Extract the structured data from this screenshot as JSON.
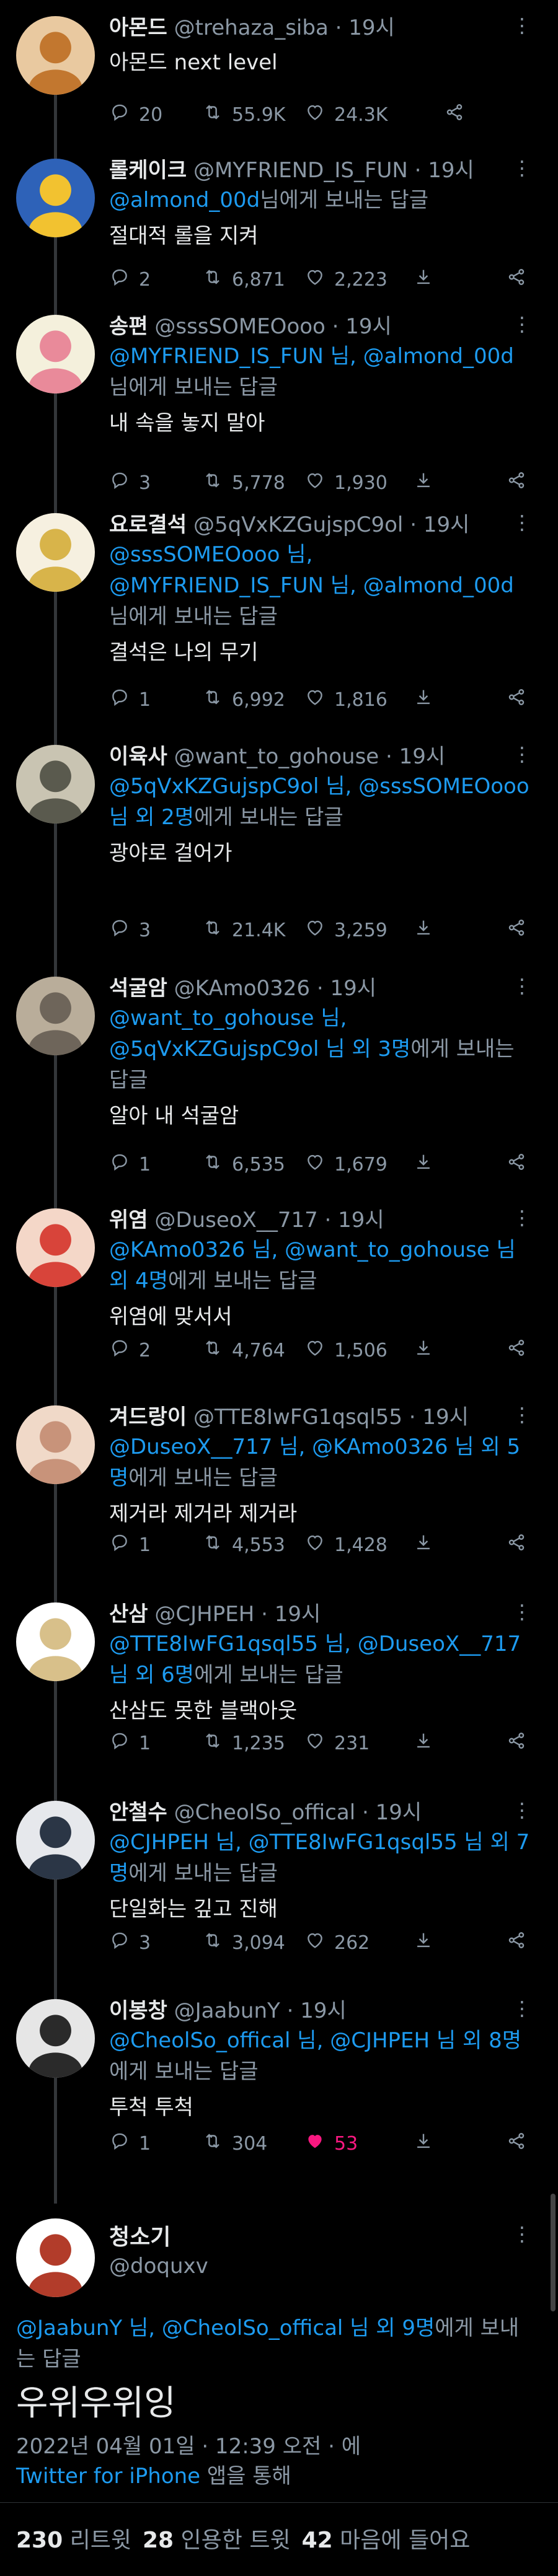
{
  "tweets": [
    {
      "name": "아몬드",
      "handle": "@trehaza_siba",
      "time": "19시",
      "replying_to": [],
      "reply_suffix": "",
      "text": "아몬드 next level",
      "replies": "20",
      "retweets": "55.9K",
      "likes": "24.3K",
      "avatar_colors": [
        "#c2772f",
        "#e9c9a0"
      ]
    },
    {
      "name": "롤케이크",
      "handle": "@MYFRIEND_IS_FUN",
      "time": "19시",
      "replying_to": [
        "@almond_00d"
      ],
      "reply_suffix": "님에게 보내는 답글",
      "text": "절대적 롤을 지켜",
      "replies": "2",
      "retweets": "6,871",
      "likes": "2,223",
      "avatar_colors": [
        "#f2c230",
        "#2e62b8"
      ]
    },
    {
      "name": "송편",
      "handle": "@sssSOMEOooo",
      "time": "19시",
      "replying_to": [
        "@MYFRIEND_IS_FUN 님",
        "@almond_00d"
      ],
      "reply_suffix": "님에게 보내는 답글",
      "text": "내 속을 놓지 말아",
      "replies": "3",
      "retweets": "5,778",
      "likes": "1,930",
      "avatar_colors": [
        "#e98a9a",
        "#f4f0dc"
      ]
    },
    {
      "name": "요로결석",
      "handle": "@5qVxKZGujspC9ol",
      "time": "19시",
      "replying_to": [
        "@sssSOMEOooo 님",
        "@MYFRIEND_IS_FUN 님",
        "@almond_00d"
      ],
      "reply_suffix": "님에게 보내는 답글",
      "text": "결석은 나의 무기",
      "replies": "1",
      "retweets": "6,992",
      "likes": "1,816",
      "avatar_colors": [
        "#d8b44a",
        "#f6f0e0"
      ]
    },
    {
      "name": "이육사",
      "handle": "@want_to_gohouse",
      "time": "19시",
      "replying_to": [
        "@5qVxKZGujspC9ol 님",
        "@sssSOMEOooo 님 외 2명"
      ],
      "reply_suffix": "에게 보내는 답글",
      "text": "광야로 걸어가",
      "replies": "3",
      "retweets": "21.4K",
      "likes": "3,259",
      "avatar_colors": [
        "#5a5a4e",
        "#c9c4b2"
      ]
    },
    {
      "name": "석굴암",
      "handle": "@KAmo0326",
      "time": "19시",
      "replying_to": [
        "@want_to_gohouse 님",
        "@5qVxKZGujspC9ol 님 외 3명"
      ],
      "reply_suffix": "에게 보내는 답글",
      "text": "알아 내 석굴암",
      "replies": "1",
      "retweets": "6,535",
      "likes": "1,679",
      "avatar_colors": [
        "#6e655a",
        "#b9ad9a"
      ]
    },
    {
      "name": "위염",
      "handle": "@DuseoX__717",
      "time": "19시",
      "replying_to": [
        "@KAmo0326 님",
        "@want_to_gohouse 님 외 4명"
      ],
      "reply_suffix": "에게 보내는 답글",
      "text": "위염에 맞서서",
      "replies": "2",
      "retweets": "4,764",
      "likes": "1,506",
      "avatar_colors": [
        "#d8443a",
        "#f4d7c8"
      ]
    },
    {
      "name": "겨드랑이",
      "handle": "@TTE8IwFG1qsql55",
      "time": "19시",
      "replying_to": [
        "@DuseoX__717 님",
        "@KAmo0326 님 외 5명"
      ],
      "reply_suffix": "에게 보내는 답글",
      "text": "제거라 제거라 제거라",
      "replies": "1",
      "retweets": "4,553",
      "likes": "1,428",
      "avatar_colors": [
        "#c8937a",
        "#f0d9c8"
      ]
    },
    {
      "name": "산삼",
      "handle": "@CJHPEH",
      "time": "19시",
      "replying_to": [
        "@TTE8IwFG1qsql55 님",
        "@DuseoX__717 님 외 6명"
      ],
      "reply_suffix": "에게 보내는 답글",
      "text": "산삼도 못한 블랙아웃",
      "replies": "1",
      "retweets": "1,235",
      "likes": "231",
      "avatar_colors": [
        "#d8c08a",
        "#ffffff"
      ]
    },
    {
      "name": "안철수",
      "handle": "@CheolSo_offical",
      "time": "19시",
      "replying_to": [
        "@CJHPEH 님",
        "@TTE8IwFG1qsql55 님 외 7명"
      ],
      "reply_suffix": "에게 보내는 답글",
      "text": "단일화는 깊고 진해",
      "replies": "3",
      "retweets": "3,094",
      "likes": "262",
      "avatar_colors": [
        "#2b3646",
        "#e6e8ec"
      ]
    },
    {
      "name": "이봉창",
      "handle": "@JaabunY",
      "time": "19시",
      "replying_to": [
        "@CheolSo_offical 님",
        "@CJHPEH 님 외 8명"
      ],
      "reply_suffix": "에게 보내는 답글",
      "text": "투척 투척",
      "replies": "1",
      "retweets": "304",
      "likes": "53",
      "liked": true,
      "avatar_colors": [
        "#2a2a2a",
        "#e6e6e6"
      ]
    }
  ],
  "main_tweet": {
    "name": "청소기",
    "handle": "@doquxv",
    "replying_to": [
      "@JaabunY 님",
      "@CheolSo_offical 님 외 9명"
    ],
    "reply_suffix": "에게 보내는 답글",
    "text": "우위우위잉",
    "timestamp": "2022년 04월 01일 · 12:39 오전 · 에",
    "client": "Twitter for iPhone",
    "client_suffix": " 앱을 통해",
    "retweets": "230",
    "retweets_label": "리트윗",
    "quotes": "28",
    "quotes_label": "인용한 트윗",
    "likes": "42",
    "likes_label": "마음에 들어요",
    "avatar_colors": [
      "#b23c2a",
      "#ffffff"
    ]
  },
  "accent_color": "#1d9bf0",
  "like_color": "#f91880",
  "icons": [
    "reply-icon",
    "retweet-icon",
    "like-icon",
    "share-icon",
    "more-icon"
  ]
}
